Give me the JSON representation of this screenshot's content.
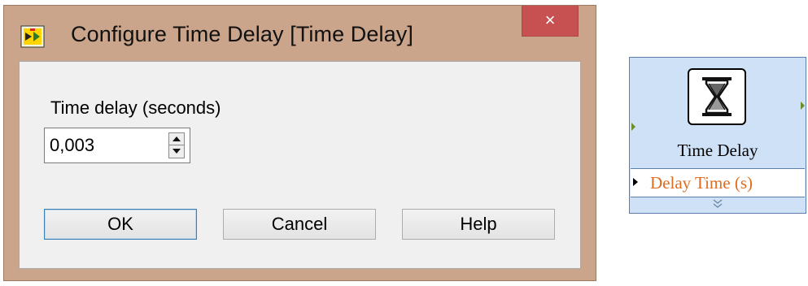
{
  "dialog": {
    "title": "Configure Time Delay [Time Delay]",
    "close_glyph": "×",
    "field_label": "Time delay (seconds)",
    "field_value": "0,003",
    "buttons": {
      "ok": "OK",
      "cancel": "Cancel",
      "help": "Help"
    }
  },
  "node": {
    "name": "Time Delay",
    "param_label": "Delay Time (s)",
    "icon": "hourglass-icon",
    "expand_icon": "double-chevron-down-icon"
  },
  "colors": {
    "titlebar": "#caa58b",
    "close_button": "#c75050",
    "node_background": "#cfe1f7",
    "param_text": "#e06b1f",
    "terminal": "#6c8f2a"
  }
}
